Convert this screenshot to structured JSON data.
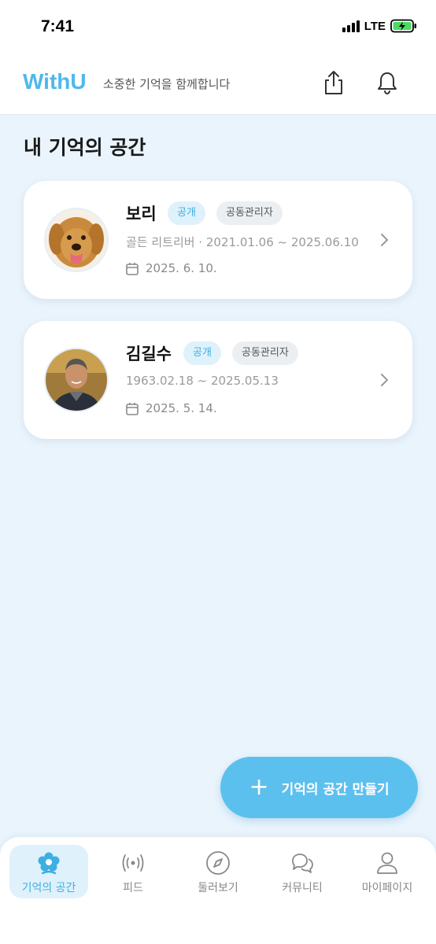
{
  "status": {
    "time": "7:41",
    "network": "LTE"
  },
  "header": {
    "logo": "WithU",
    "tagline": "소중한 기억을 함께합니다",
    "share_icon": "share-icon",
    "bell_icon": "bell-icon"
  },
  "page": {
    "title": "내 기억의 공간"
  },
  "memorials": [
    {
      "name": "보리",
      "visibility": "공개",
      "role": "공동관리자",
      "description": "골든 리트리버 · 2021.01.06 ~ 2025.06.10",
      "date": "2025. 6. 10."
    },
    {
      "name": "김길수",
      "visibility": "공개",
      "role": "공동관리자",
      "description": "1963.02.18 ~ 2025.05.13",
      "date": "2025. 5. 14."
    }
  ],
  "fab": {
    "label": "기억의 공간 만들기",
    "icon": "plus-icon"
  },
  "tabs": [
    {
      "label": "기억의 공간",
      "icon": "flower-icon",
      "active": true
    },
    {
      "label": "피드",
      "icon": "broadcast-icon",
      "active": false
    },
    {
      "label": "둘러보기",
      "icon": "compass-icon",
      "active": false
    },
    {
      "label": "커뮤니티",
      "icon": "chat-icon",
      "active": false
    },
    {
      "label": "마이페이지",
      "icon": "person-icon",
      "active": false
    }
  ],
  "colors": {
    "accent": "#5cc0ee",
    "brand": "#4fb8ea",
    "background": "#eaf4fc"
  }
}
